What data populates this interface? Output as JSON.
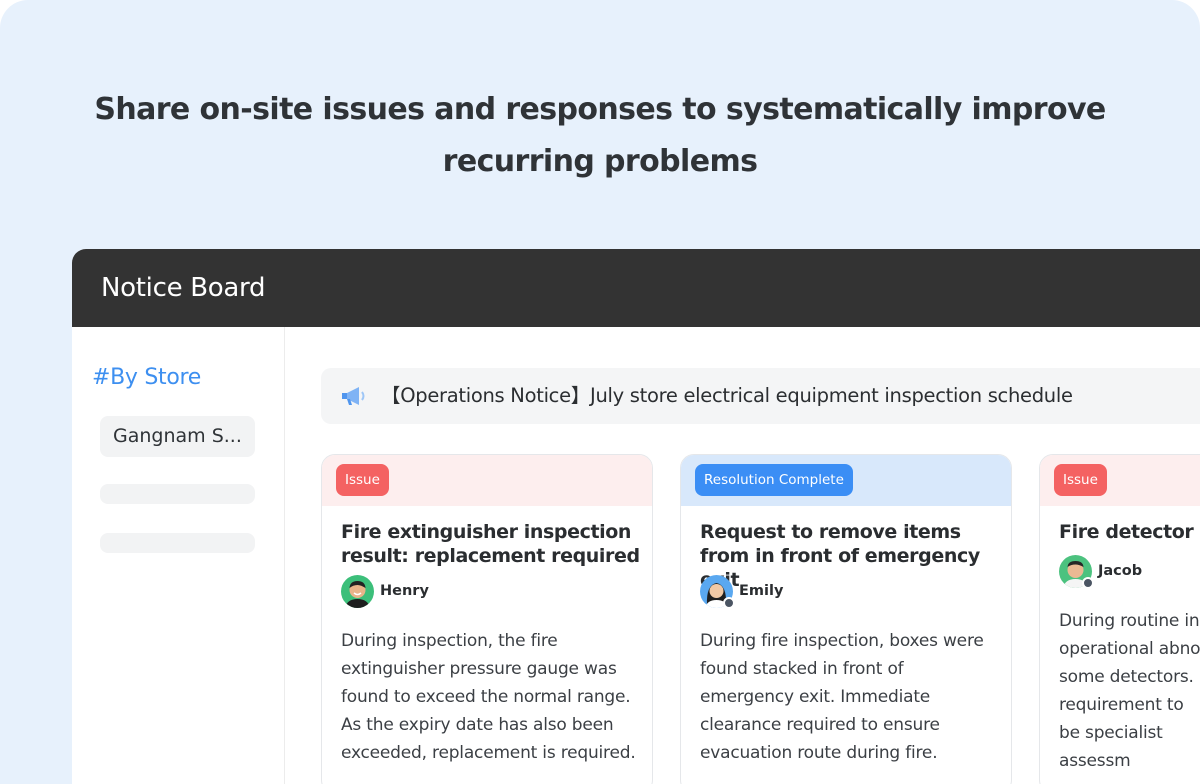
{
  "hero": {
    "line1": "Share on-site issues and responses to systematically improve",
    "line2": "recurring problems"
  },
  "app": {
    "title": "Notice Board",
    "sidebar": {
      "heading": "#By Store",
      "stores": [
        "Gangnam S..."
      ]
    },
    "notice": {
      "icon": "megaphone-icon",
      "text": "【Operations Notice】July store electrical equipment inspection schedule"
    },
    "cards": [
      {
        "status": "Issue",
        "title": "Fire extinguisher inspection result: replacement required",
        "author": "Henry",
        "body": "During inspection, the fire extinguisher pressure gauge was found to exceed the normal range. As the expiry date has also been exceeded, replacement is required."
      },
      {
        "status": "Resolution Complete",
        "title": "Request to remove items from in front of emergency exit",
        "author": "Emily",
        "body": "During fire inspection, boxes were found stacked in front of emergency exit. Immediate clearance required to ensure evacuation route during fire."
      },
      {
        "status": "Issue",
        "title": "Fire detector m",
        "author": "Jacob",
        "body": "During routine ins operational abnor some detectors. I requirement to be specialist assessm"
      }
    ]
  },
  "colors": {
    "background": "#e7f1fc",
    "header": "#333333",
    "accent": "#3d8ff0",
    "issue_badge": "#f46262",
    "resolved_badge": "#3b8ef5"
  }
}
